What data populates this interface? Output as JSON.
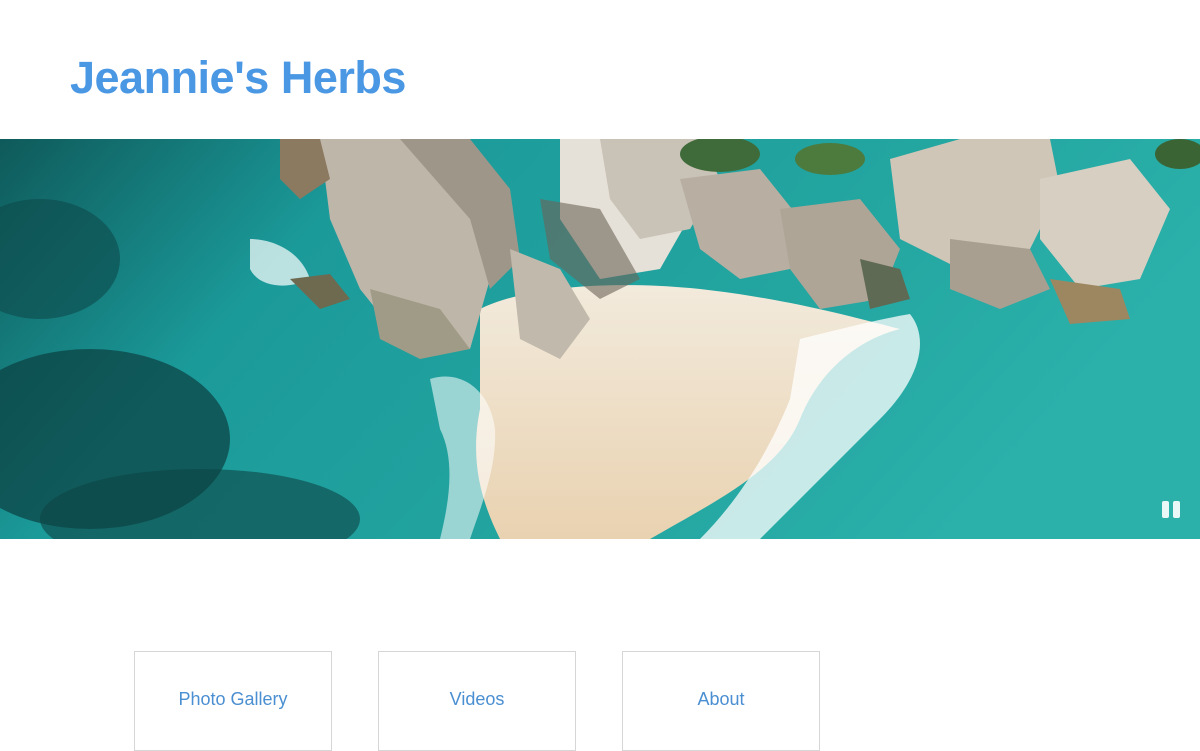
{
  "header": {
    "title": "Jeannie's Herbs"
  },
  "hero": {
    "description_icon": "pause-icon"
  },
  "nav": {
    "items": [
      {
        "label": "Photo Gallery"
      },
      {
        "label": "Videos"
      },
      {
        "label": "About"
      }
    ]
  },
  "colors": {
    "title": "#4a97e4",
    "nav_text": "#4a8fd1",
    "nav_border": "#d6d6d6",
    "ocean": "#1f8e92",
    "sand": "#e9d7bb"
  }
}
